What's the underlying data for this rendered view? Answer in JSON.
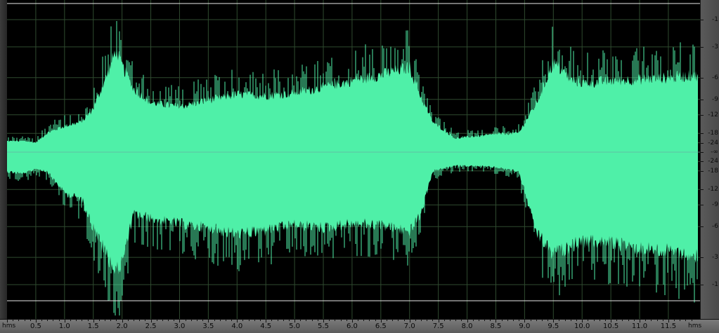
{
  "editor": {
    "time_ruler": {
      "unit_left": "hms",
      "unit_right": "hms",
      "labels": [
        "0.5",
        "1.0",
        "1.5",
        "2.0",
        "2.5",
        "3.0",
        "3.5",
        "4.0",
        "4.5",
        "5.0",
        "5.5",
        "6.0",
        "6.5",
        "7.0",
        "7.5",
        "8.0",
        "8.5",
        "9.0",
        "9.5",
        "10.0",
        "10.5",
        "11.0",
        "11.5"
      ]
    },
    "db_ruler": {
      "labels": [
        "-1",
        "-3",
        "-6",
        "-9",
        "-12",
        "-18",
        "-24",
        "-∞",
        "-24",
        "-18",
        "-12",
        "-9",
        "-6",
        "-3",
        "-1"
      ]
    },
    "waveform": {
      "color": "#4ff0a8",
      "background": "#000000",
      "grid_color": "#2f4a2f",
      "envelope_seconds": [
        0.0,
        0.3,
        0.5,
        0.7,
        1.0,
        1.3,
        1.5,
        1.7,
        1.9,
        2.0,
        2.2,
        2.5,
        3.0,
        3.5,
        4.0,
        4.5,
        5.0,
        5.5,
        6.0,
        6.5,
        7.0,
        7.2,
        7.4,
        7.8,
        8.0,
        8.5,
        8.9,
        9.2,
        9.5,
        9.8,
        10.0,
        10.5,
        11.0,
        11.5,
        11.95
      ],
      "envelope_top": [
        0.08,
        0.08,
        0.07,
        0.14,
        0.19,
        0.22,
        0.32,
        0.52,
        0.75,
        0.63,
        0.46,
        0.36,
        0.33,
        0.38,
        0.42,
        0.41,
        0.43,
        0.47,
        0.52,
        0.56,
        0.62,
        0.4,
        0.22,
        0.1,
        0.11,
        0.13,
        0.14,
        0.35,
        0.65,
        0.53,
        0.5,
        0.52,
        0.53,
        0.54,
        0.56
      ],
      "envelope_bottom": [
        0.14,
        0.16,
        0.12,
        0.14,
        0.3,
        0.34,
        0.55,
        0.72,
        0.88,
        0.8,
        0.45,
        0.48,
        0.52,
        0.55,
        0.6,
        0.57,
        0.53,
        0.55,
        0.52,
        0.53,
        0.58,
        0.45,
        0.14,
        0.1,
        0.1,
        0.11,
        0.14,
        0.58,
        0.75,
        0.68,
        0.65,
        0.66,
        0.7,
        0.72,
        0.75
      ]
    }
  }
}
